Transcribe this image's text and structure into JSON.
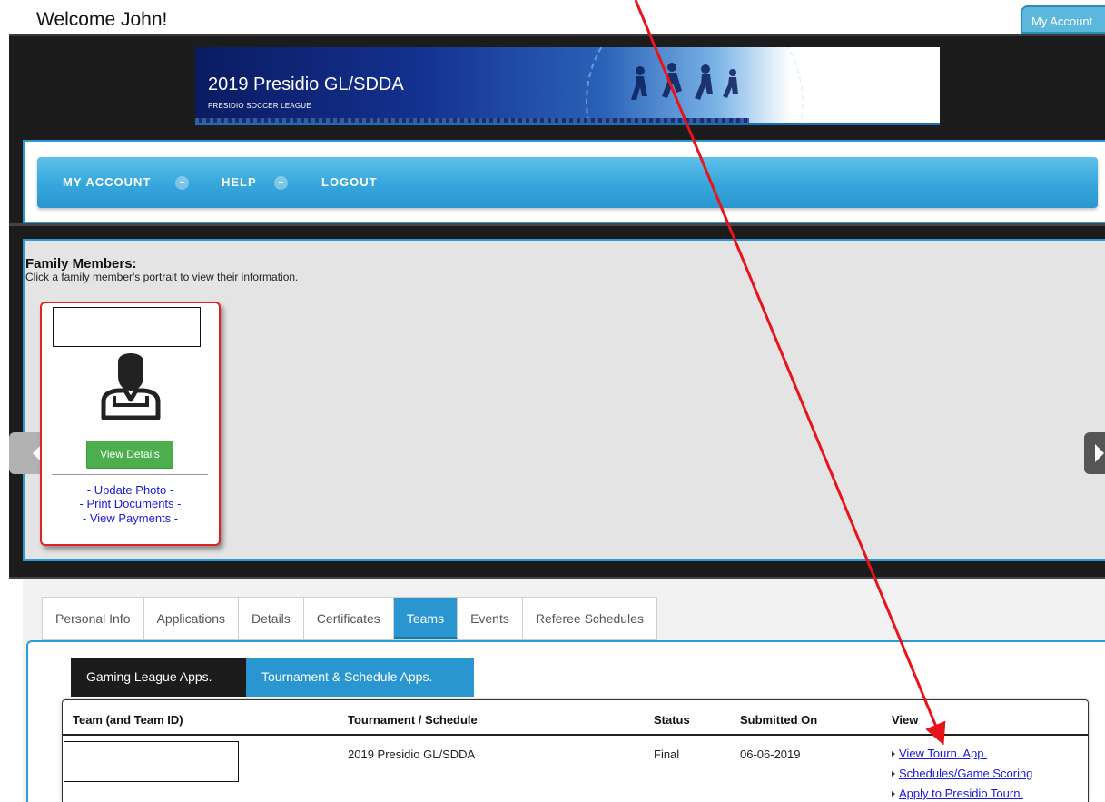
{
  "header": {
    "welcome": "Welcome John!",
    "my_account_label": "My Account"
  },
  "banner": {
    "title": "2019 Presidio GL/SDDA",
    "subtitle": "PRESIDIO SOCCER LEAGUE"
  },
  "nav": {
    "items": [
      {
        "label": "MY ACCOUNT",
        "has_dropdown": true
      },
      {
        "label": "HELP",
        "has_dropdown": true
      },
      {
        "label": "LOGOUT",
        "has_dropdown": false
      }
    ]
  },
  "family": {
    "title": "Family Members:",
    "instructions": "Click a family member's portrait to view their information.",
    "card": {
      "view_details_label": "View Details",
      "links": [
        "- Update Photo -",
        "- Print Documents -",
        "- View Payments -"
      ]
    }
  },
  "tabs": {
    "items": [
      "Personal Info",
      "Applications",
      "Details",
      "Certificates",
      "Teams",
      "Events",
      "Referee Schedules"
    ],
    "active": "Teams"
  },
  "subtabs": {
    "items": [
      "Gaming League Apps.",
      "Tournament & Schedule Apps."
    ],
    "active": "Tournament & Schedule Apps."
  },
  "table": {
    "columns": [
      "Team (and Team ID)",
      "Tournament / Schedule",
      "Status",
      "Submitted On",
      "View"
    ],
    "rows": [
      {
        "tournament": "2019 Presidio GL/SDDA",
        "status": "Final",
        "submitted_on": "06-06-2019",
        "view_links": [
          "View Tourn. App.",
          "Schedules/Game Scoring",
          "Apply to Presidio Tourn."
        ]
      }
    ]
  },
  "colors": {
    "accent_blue": "#2a96cf",
    "card_border_red": "#e02323",
    "button_green": "#4cae4c",
    "link_blue": "#1a1adb",
    "annotation_red": "#e8141a"
  }
}
